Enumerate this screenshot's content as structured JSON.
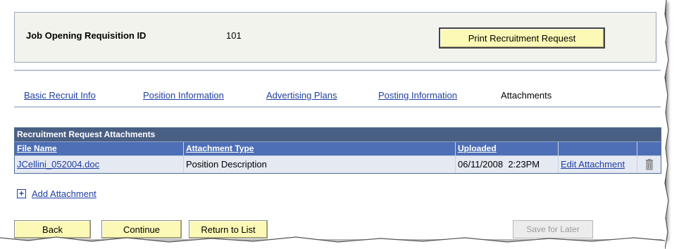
{
  "header": {
    "req_label": "Job Opening Requisition ID",
    "req_value": "101",
    "print_button": "Print Recruitment Request"
  },
  "tabs": [
    {
      "label": "Basic Recruit Info",
      "active": false
    },
    {
      "label": "Position Information",
      "active": false
    },
    {
      "label": "Advertising Plans",
      "active": false
    },
    {
      "label": "Posting Information",
      "active": false
    },
    {
      "label": "Attachments",
      "active": true
    }
  ],
  "grid": {
    "title": "Recruitment Request Attachments",
    "columns": [
      "File Name",
      "Attachment Type",
      "Uploaded",
      "",
      ""
    ],
    "rows": [
      {
        "file_name": "JCellini_052004.doc",
        "attachment_type": "Position Description",
        "uploaded": "06/11/2008  2:23PM",
        "action": "Edit Attachment",
        "delete_icon": "trash-icon"
      }
    ]
  },
  "add_attachment": {
    "label": "Add Attachment",
    "icon": "plus-icon"
  },
  "buttons": {
    "back": "Back",
    "continue": "Continue",
    "return_to_list": "Return to List",
    "save_for_later": "Save for Later"
  },
  "colors": {
    "grid_title_bg": "#4a5f84",
    "grid_header_bg": "#4e6fb5",
    "row_bg": "#e5e9f2",
    "button_bg": "#fbf9b5",
    "link": "#1f3fa3"
  }
}
